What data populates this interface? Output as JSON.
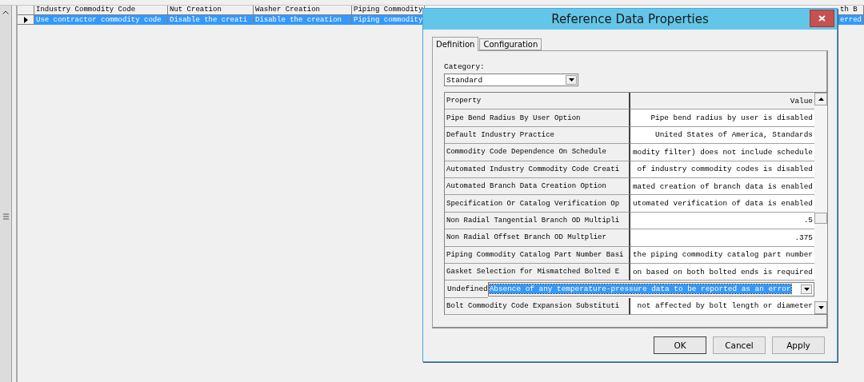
{
  "grid": {
    "columns": [
      "Industry Commodity Code",
      "Nut Creation",
      "Washer Creation",
      "Piping Commodity",
      "th B"
    ],
    "rows": [
      {
        "selected": true,
        "cells": [
          "Use contractor commodity code",
          "Disable the creati",
          "Disable the creation",
          "Piping commodity",
          "erred"
        ]
      }
    ]
  },
  "dialog": {
    "title": "Reference Data Properties",
    "tabs": [
      {
        "label": "Definition",
        "selected": true
      },
      {
        "label": "Configuration",
        "selected": false
      }
    ],
    "category": {
      "label": "Category:",
      "value": "Standard"
    },
    "properties": {
      "columns": [
        "Property",
        "Value"
      ],
      "rows": [
        {
          "kind": "text",
          "selected": false,
          "name": "Pipe Bend Radius By User Option",
          "value": "Pipe bend radius by user is disabled"
        },
        {
          "kind": "text",
          "selected": false,
          "name": "Default Industry Practice",
          "value": "United States of America, Standards"
        },
        {
          "kind": "text",
          "selected": false,
          "name": "Commodity Code Dependence On Schedule",
          "value": "modity filter) does not include schedule"
        },
        {
          "kind": "text",
          "selected": false,
          "name": "Automated Industry Commodity Code Creati",
          "value": "of industry commodity codes is disabled"
        },
        {
          "kind": "text",
          "selected": false,
          "name": "Automated Branch Data Creation Option",
          "value": "mated creation of branch data is enabled"
        },
        {
          "kind": "text",
          "selected": false,
          "name": "Specification Or Catalog Verification Op",
          "value": "utomated verification of data is enabled"
        },
        {
          "kind": "text",
          "selected": false,
          "name": "Non Radial Tangential Branch OD Multipli",
          "value": ".5"
        },
        {
          "kind": "text",
          "selected": false,
          "name": "Non Radial Offset Branch OD Multplier",
          "value": ".375"
        },
        {
          "kind": "text",
          "selected": false,
          "name": "Piping Commodity Catalog Part Number Basi",
          "value": "the piping commodity catalog part number"
        },
        {
          "kind": "text",
          "selected": false,
          "name": "Gasket Selection for Mismatched Bolted E",
          "value": "on based on both bolted ends is required"
        },
        {
          "kind": "dropdown",
          "selected": true,
          "name": "Undefined",
          "value": "Absence of any temperature-pressure data to be reported as an error"
        },
        {
          "kind": "text",
          "selected": false,
          "name": "Bolt Commodity Code Expansion Substituti",
          "value": "not affected by bolt length or diameter"
        }
      ]
    },
    "buttons": [
      "OK",
      "Cancel",
      "Apply"
    ]
  }
}
